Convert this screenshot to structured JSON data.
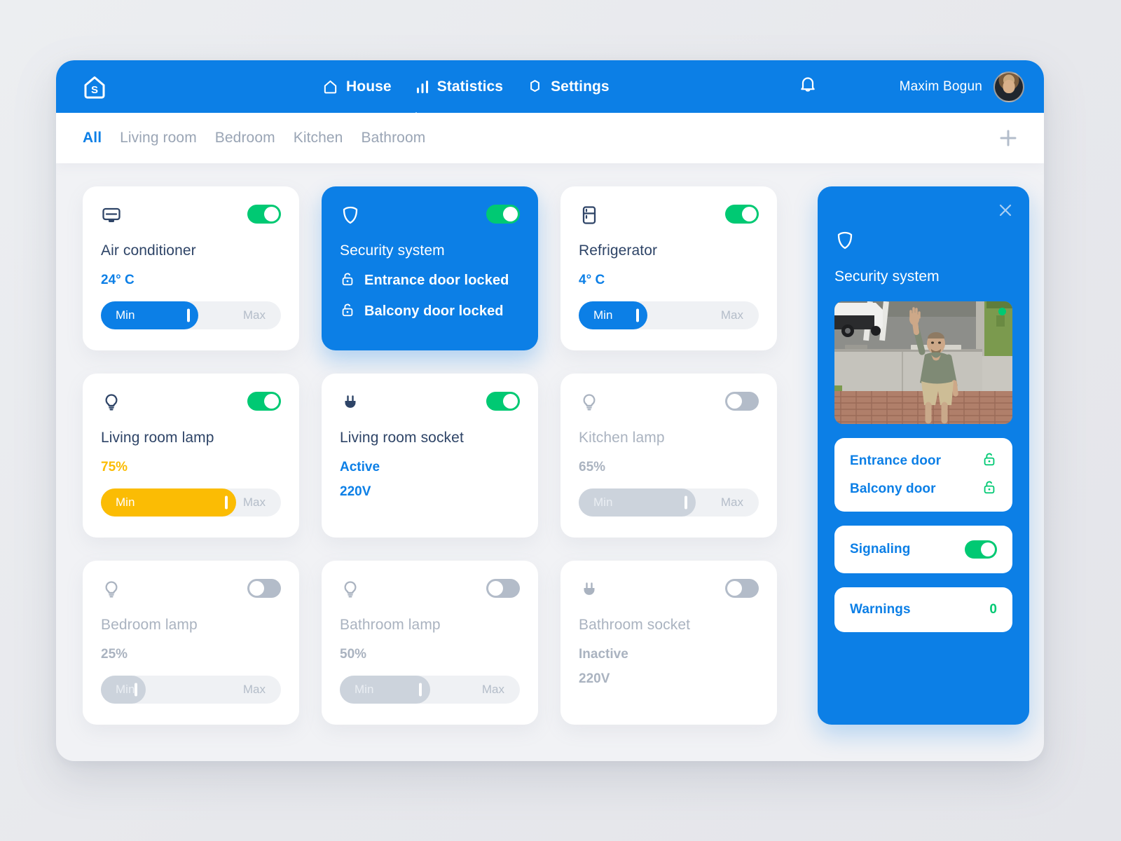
{
  "header": {
    "logo_icon": "house-s-logo",
    "nav": [
      {
        "label": "House",
        "icon": "house-icon",
        "active": true
      },
      {
        "label": "Statistics",
        "icon": "bar-chart-icon",
        "active": false
      },
      {
        "label": "Settings",
        "icon": "gear-icon",
        "active": false
      }
    ],
    "bell_icon": "bell-icon",
    "user_name": "Maxim Bogun",
    "avatar_icon": "user-avatar",
    "bg_color": "#0C7FE6"
  },
  "tabbar": {
    "tabs": [
      {
        "label": "All",
        "active": true
      },
      {
        "label": "Living room",
        "active": false
      },
      {
        "label": "Bedroom",
        "active": false
      },
      {
        "label": "Kitchen",
        "active": false
      },
      {
        "label": "Bathroom",
        "active": false
      }
    ],
    "add_icon": "plus-icon"
  },
  "cards": [
    {
      "id": "air-conditioner",
      "icon": "air-conditioner-icon",
      "title": "Air conditioner",
      "value": "24° C",
      "toggle_on": true,
      "enabled": true,
      "accent": false,
      "slider": {
        "min_label": "Min",
        "max_label": "Max",
        "percent": 54,
        "color": "blue"
      }
    },
    {
      "id": "security-system",
      "icon": "shield-icon",
      "title": "Security system",
      "toggle_on": true,
      "enabled": true,
      "accent": true,
      "items": [
        {
          "icon": "lock-icon",
          "label": "Entrance door locked"
        },
        {
          "icon": "lock-icon",
          "label": "Balcony door locked"
        }
      ]
    },
    {
      "id": "refrigerator",
      "icon": "refrigerator-icon",
      "title": "Refrigerator",
      "value": "4° C",
      "toggle_on": true,
      "enabled": true,
      "accent": false,
      "slider": {
        "min_label": "Min",
        "max_label": "Max",
        "percent": 38,
        "color": "blue"
      }
    },
    {
      "id": "living-room-lamp",
      "icon": "lamp-icon",
      "title": "Living room lamp",
      "value": "75%",
      "toggle_on": true,
      "enabled": true,
      "accent": false,
      "slider": {
        "min_label": "Min",
        "max_label": "Max",
        "percent": 75,
        "color": "yellow"
      }
    },
    {
      "id": "living-room-socket",
      "icon": "socket-icon",
      "title": "Living room socket",
      "value": "Active",
      "value2": "220V",
      "toggle_on": true,
      "enabled": true,
      "accent": false
    },
    {
      "id": "kitchen-lamp",
      "icon": "lamp-icon",
      "title": "Kitchen lamp",
      "value": "65%",
      "toggle_on": false,
      "enabled": false,
      "accent": false,
      "slider": {
        "min_label": "Min",
        "max_label": "Max",
        "percent": 65,
        "color": "grey"
      }
    },
    {
      "id": "bedroom-lamp",
      "icon": "lamp-icon",
      "title": "Bedroom lamp",
      "value": "25%",
      "toggle_on": false,
      "enabled": false,
      "accent": false,
      "slider": {
        "min_label": "Min",
        "max_label": "Max",
        "percent": 25,
        "color": "grey"
      }
    },
    {
      "id": "bathroom-lamp",
      "icon": "lamp-icon",
      "title": "Bathroom lamp",
      "value": "50%",
      "toggle_on": false,
      "enabled": false,
      "accent": false,
      "slider": {
        "min_label": "Min",
        "max_label": "Max",
        "percent": 50,
        "color": "grey"
      }
    },
    {
      "id": "bathroom-socket",
      "icon": "socket-icon",
      "title": "Bathroom socket",
      "value": "Inactive",
      "value2": "220V",
      "toggle_on": false,
      "enabled": false,
      "accent": false
    }
  ],
  "panel": {
    "close_icon": "close-icon",
    "shield_icon": "shield-icon",
    "title": "Security system",
    "camera": {
      "icon": "camera-feed",
      "recording_dot": true
    },
    "doors": [
      {
        "label": "Entrance door",
        "icon": "lock-icon",
        "locked": true
      },
      {
        "label": "Balcony door",
        "icon": "lock-icon",
        "locked": true
      }
    ],
    "signaling": {
      "label": "Signaling",
      "toggle_on": true
    },
    "warnings": {
      "label": "Warnings",
      "count": "0"
    }
  },
  "colors": {
    "accent_blue": "#0C7FE6",
    "toggle_green": "#00C973",
    "yellow": "#FBBC04",
    "text_dark": "#2e4467",
    "text_muted": "#aab3c0"
  }
}
